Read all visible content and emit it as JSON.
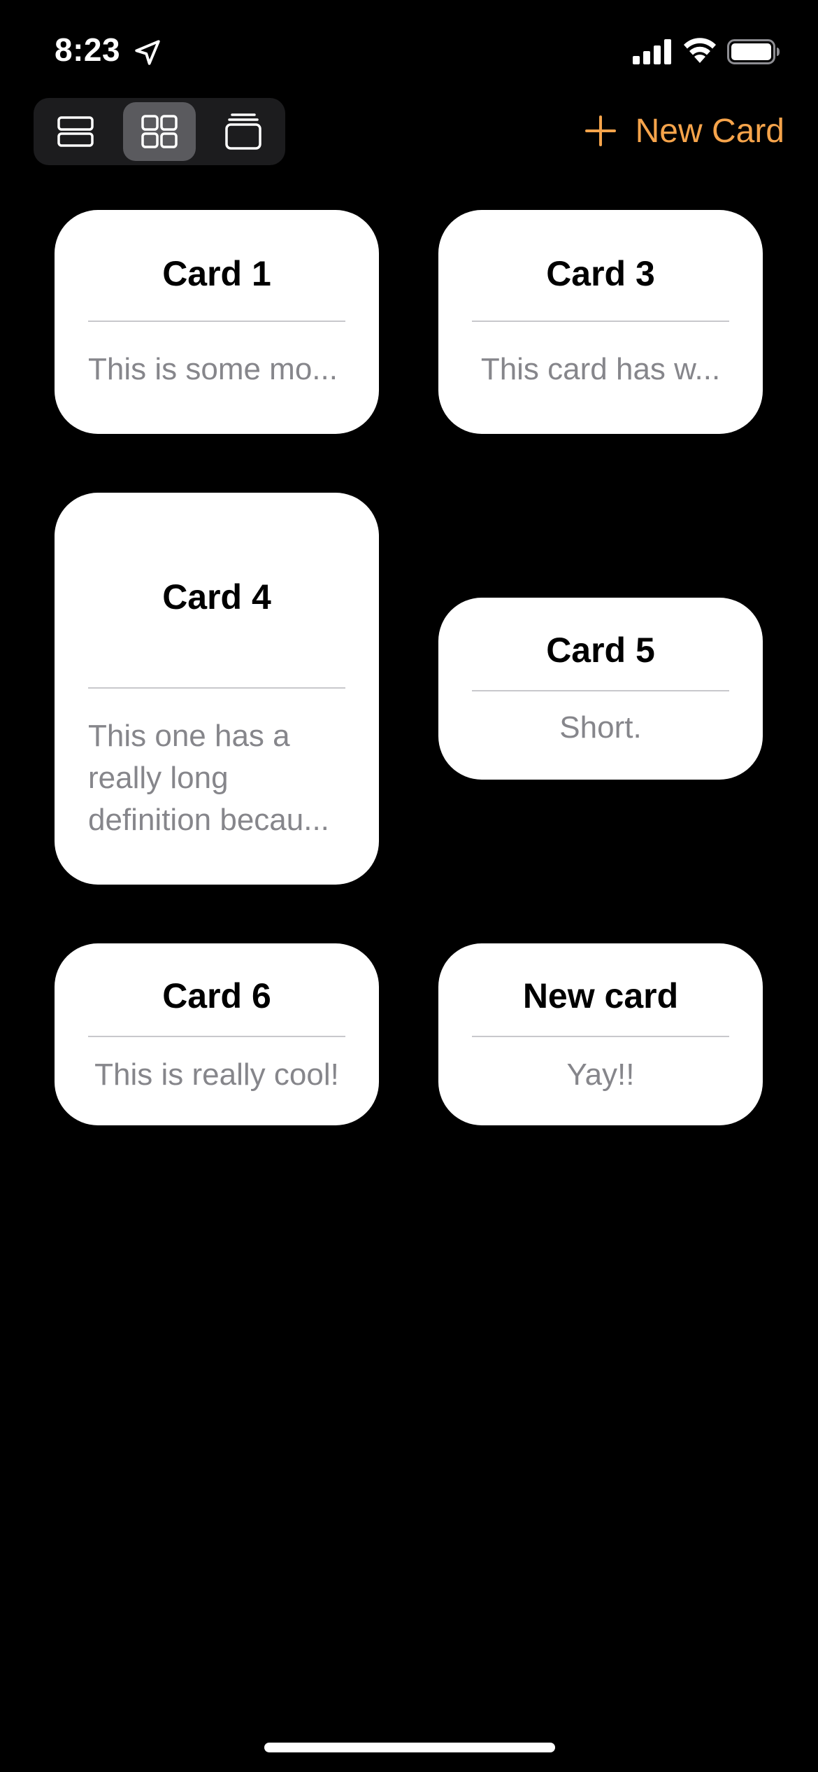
{
  "status_bar": {
    "time": "8:23",
    "icons": [
      "location-arrow-icon",
      "cellular-signal-icon",
      "wifi-icon",
      "battery-icon"
    ]
  },
  "toolbar": {
    "view_modes": [
      {
        "name": "list-view",
        "icon": "list-rows-icon",
        "selected": false
      },
      {
        "name": "grid-view",
        "icon": "grid-icon",
        "selected": true
      },
      {
        "name": "stack-view",
        "icon": "card-stack-icon",
        "selected": false
      }
    ],
    "new_card_label": "New Card",
    "accent_color": "#f6a44b"
  },
  "cards": [
    {
      "title": "Card 1",
      "body": "This is some mo..."
    },
    {
      "title": "Card 3",
      "body": "This card has w..."
    },
    {
      "title": "Card 4",
      "body": "This one has a really long definition becau..."
    },
    {
      "title": "Card 5",
      "body": "Short."
    },
    {
      "title": "Card 6",
      "body": "This is really cool!"
    },
    {
      "title": "New card",
      "body": "Yay!!"
    }
  ]
}
